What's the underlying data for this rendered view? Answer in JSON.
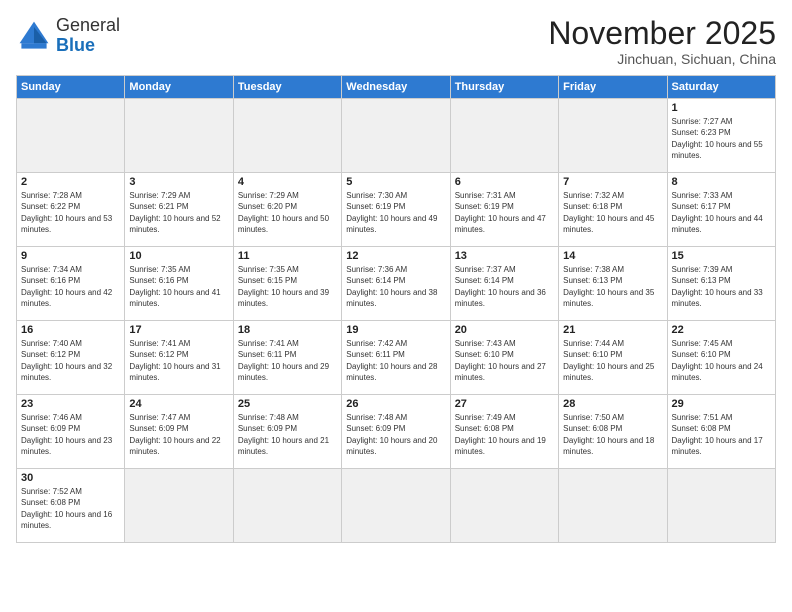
{
  "header": {
    "logo_general": "General",
    "logo_blue": "Blue",
    "month_title": "November 2025",
    "location": "Jinchuan, Sichuan, China"
  },
  "days_of_week": [
    "Sunday",
    "Monday",
    "Tuesday",
    "Wednesday",
    "Thursday",
    "Friday",
    "Saturday"
  ],
  "weeks": [
    [
      {
        "day": "",
        "info": ""
      },
      {
        "day": "",
        "info": ""
      },
      {
        "day": "",
        "info": ""
      },
      {
        "day": "",
        "info": ""
      },
      {
        "day": "",
        "info": ""
      },
      {
        "day": "",
        "info": ""
      },
      {
        "day": "1",
        "info": "Sunrise: 7:27 AM\nSunset: 6:23 PM\nDaylight: 10 hours and 55 minutes."
      }
    ],
    [
      {
        "day": "2",
        "info": "Sunrise: 7:28 AM\nSunset: 6:22 PM\nDaylight: 10 hours and 53 minutes."
      },
      {
        "day": "3",
        "info": "Sunrise: 7:29 AM\nSunset: 6:21 PM\nDaylight: 10 hours and 52 minutes."
      },
      {
        "day": "4",
        "info": "Sunrise: 7:29 AM\nSunset: 6:20 PM\nDaylight: 10 hours and 50 minutes."
      },
      {
        "day": "5",
        "info": "Sunrise: 7:30 AM\nSunset: 6:19 PM\nDaylight: 10 hours and 49 minutes."
      },
      {
        "day": "6",
        "info": "Sunrise: 7:31 AM\nSunset: 6:19 PM\nDaylight: 10 hours and 47 minutes."
      },
      {
        "day": "7",
        "info": "Sunrise: 7:32 AM\nSunset: 6:18 PM\nDaylight: 10 hours and 45 minutes."
      },
      {
        "day": "8",
        "info": "Sunrise: 7:33 AM\nSunset: 6:17 PM\nDaylight: 10 hours and 44 minutes."
      }
    ],
    [
      {
        "day": "9",
        "info": "Sunrise: 7:34 AM\nSunset: 6:16 PM\nDaylight: 10 hours and 42 minutes."
      },
      {
        "day": "10",
        "info": "Sunrise: 7:35 AM\nSunset: 6:16 PM\nDaylight: 10 hours and 41 minutes."
      },
      {
        "day": "11",
        "info": "Sunrise: 7:35 AM\nSunset: 6:15 PM\nDaylight: 10 hours and 39 minutes."
      },
      {
        "day": "12",
        "info": "Sunrise: 7:36 AM\nSunset: 6:14 PM\nDaylight: 10 hours and 38 minutes."
      },
      {
        "day": "13",
        "info": "Sunrise: 7:37 AM\nSunset: 6:14 PM\nDaylight: 10 hours and 36 minutes."
      },
      {
        "day": "14",
        "info": "Sunrise: 7:38 AM\nSunset: 6:13 PM\nDaylight: 10 hours and 35 minutes."
      },
      {
        "day": "15",
        "info": "Sunrise: 7:39 AM\nSunset: 6:13 PM\nDaylight: 10 hours and 33 minutes."
      }
    ],
    [
      {
        "day": "16",
        "info": "Sunrise: 7:40 AM\nSunset: 6:12 PM\nDaylight: 10 hours and 32 minutes."
      },
      {
        "day": "17",
        "info": "Sunrise: 7:41 AM\nSunset: 6:12 PM\nDaylight: 10 hours and 31 minutes."
      },
      {
        "day": "18",
        "info": "Sunrise: 7:41 AM\nSunset: 6:11 PM\nDaylight: 10 hours and 29 minutes."
      },
      {
        "day": "19",
        "info": "Sunrise: 7:42 AM\nSunset: 6:11 PM\nDaylight: 10 hours and 28 minutes."
      },
      {
        "day": "20",
        "info": "Sunrise: 7:43 AM\nSunset: 6:10 PM\nDaylight: 10 hours and 27 minutes."
      },
      {
        "day": "21",
        "info": "Sunrise: 7:44 AM\nSunset: 6:10 PM\nDaylight: 10 hours and 25 minutes."
      },
      {
        "day": "22",
        "info": "Sunrise: 7:45 AM\nSunset: 6:10 PM\nDaylight: 10 hours and 24 minutes."
      }
    ],
    [
      {
        "day": "23",
        "info": "Sunrise: 7:46 AM\nSunset: 6:09 PM\nDaylight: 10 hours and 23 minutes."
      },
      {
        "day": "24",
        "info": "Sunrise: 7:47 AM\nSunset: 6:09 PM\nDaylight: 10 hours and 22 minutes."
      },
      {
        "day": "25",
        "info": "Sunrise: 7:48 AM\nSunset: 6:09 PM\nDaylight: 10 hours and 21 minutes."
      },
      {
        "day": "26",
        "info": "Sunrise: 7:48 AM\nSunset: 6:09 PM\nDaylight: 10 hours and 20 minutes."
      },
      {
        "day": "27",
        "info": "Sunrise: 7:49 AM\nSunset: 6:08 PM\nDaylight: 10 hours and 19 minutes."
      },
      {
        "day": "28",
        "info": "Sunrise: 7:50 AM\nSunset: 6:08 PM\nDaylight: 10 hours and 18 minutes."
      },
      {
        "day": "29",
        "info": "Sunrise: 7:51 AM\nSunset: 6:08 PM\nDaylight: 10 hours and 17 minutes."
      }
    ],
    [
      {
        "day": "30",
        "info": "Sunrise: 7:52 AM\nSunset: 6:08 PM\nDaylight: 10 hours and 16 minutes."
      },
      {
        "day": "",
        "info": ""
      },
      {
        "day": "",
        "info": ""
      },
      {
        "day": "",
        "info": ""
      },
      {
        "day": "",
        "info": ""
      },
      {
        "day": "",
        "info": ""
      },
      {
        "day": "",
        "info": ""
      }
    ]
  ]
}
